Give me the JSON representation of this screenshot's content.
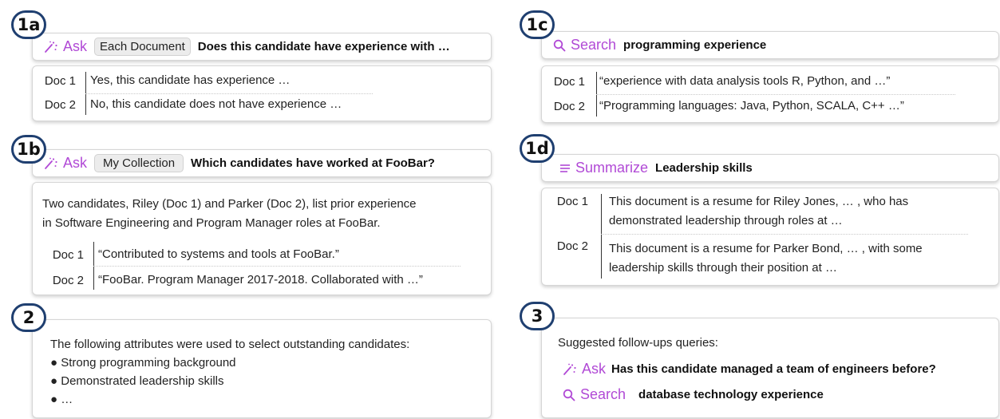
{
  "badges": {
    "b1a": "1a",
    "b1b": "1b",
    "b1c": "1c",
    "b1d": "1d",
    "b2": "2",
    "b3": "3"
  },
  "ops": {
    "ask": "Ask",
    "search": "Search",
    "summarize": "Summarize"
  },
  "p1a": {
    "scope": "Each Document",
    "question": "Does this candidate have experience with …",
    "rows": [
      {
        "doc": "Doc 1",
        "text": "Yes, this candidate has experience …"
      },
      {
        "doc": "Doc 2",
        "text": "No, this candidate does not have experience …"
      }
    ]
  },
  "p1b": {
    "scope": "My Collection",
    "question": "Which candidates have worked at FooBar?",
    "summary_line1": "Two candidates, Riley (Doc 1) and Parker (Doc 2), list prior experience",
    "summary_line2": "in Software Engineering and Program Manager roles at FooBar.",
    "rows": [
      {
        "doc": "Doc 1",
        "text": "“Contributed to systems and tools at FooBar.”"
      },
      {
        "doc": "Doc 2",
        "text": "“FooBar. Program Manager 2017-2018. Collaborated with …”"
      }
    ]
  },
  "p1c": {
    "query": "programming experience",
    "rows": [
      {
        "doc": "Doc 1",
        "text": "“experience with data analysis tools R, Python, and …”"
      },
      {
        "doc": "Doc 2",
        "text": "“Programming languages: Java, Python, SCALA, C++ …”"
      }
    ]
  },
  "p1d": {
    "topic": "Leadership skills",
    "rows": [
      {
        "doc": "Doc 1",
        "line1": "This document is a resume for Riley Jones, … , who has",
        "line2": "demonstrated leadership through roles at …"
      },
      {
        "doc": "Doc 2",
        "line1": "This document is a resume for Parker Bond, … , with some",
        "line2": "leadership skills through their position at …"
      }
    ]
  },
  "p2": {
    "intro": "The following attributes were used to select outstanding candidates:",
    "bullets": [
      "Strong programming background",
      "Demonstrated leadership skills",
      "…"
    ]
  },
  "p3": {
    "title": "Suggested follow-ups queries:",
    "ask_question": "Has this candidate managed a team of engineers before?",
    "search_query": "database technology experience"
  },
  "colors": {
    "accent": "#b14ad6",
    "badge_border": "#1f3f70"
  }
}
